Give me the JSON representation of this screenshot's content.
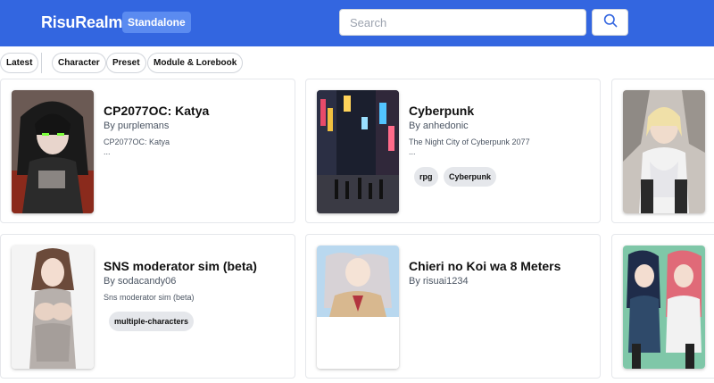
{
  "header": {
    "logo": "RisuRealm",
    "badge": "Standalone",
    "search_placeholder": "Search",
    "search_icon": "search-icon",
    "background": "#3366e0"
  },
  "filters": {
    "latest": "Latest",
    "categories": [
      "Character",
      "Preset",
      "Module & Lorebook"
    ]
  },
  "cards": [
    {
      "title": "CP2077OC: Katya",
      "author": "By purplemans",
      "description": "CP2077OC: Katya",
      "ellipsis": "...",
      "tags": []
    },
    {
      "title": "Cyberpunk",
      "author": "By anhedonic",
      "description": "The Night City of Cyberpunk 2077",
      "ellipsis": "...",
      "tags": [
        "rpg",
        "Cyberpunk"
      ]
    },
    {
      "title": "SNS moderator sim (beta)",
      "author": "By sodacandy06",
      "description": "Sns moderator sim (beta)",
      "ellipsis": "",
      "tags": [
        "multiple-characters"
      ]
    },
    {
      "title": "Chieri no Koi wa 8 Meters",
      "author": "By risuai1234",
      "description": "",
      "ellipsis": "",
      "tags": []
    }
  ]
}
